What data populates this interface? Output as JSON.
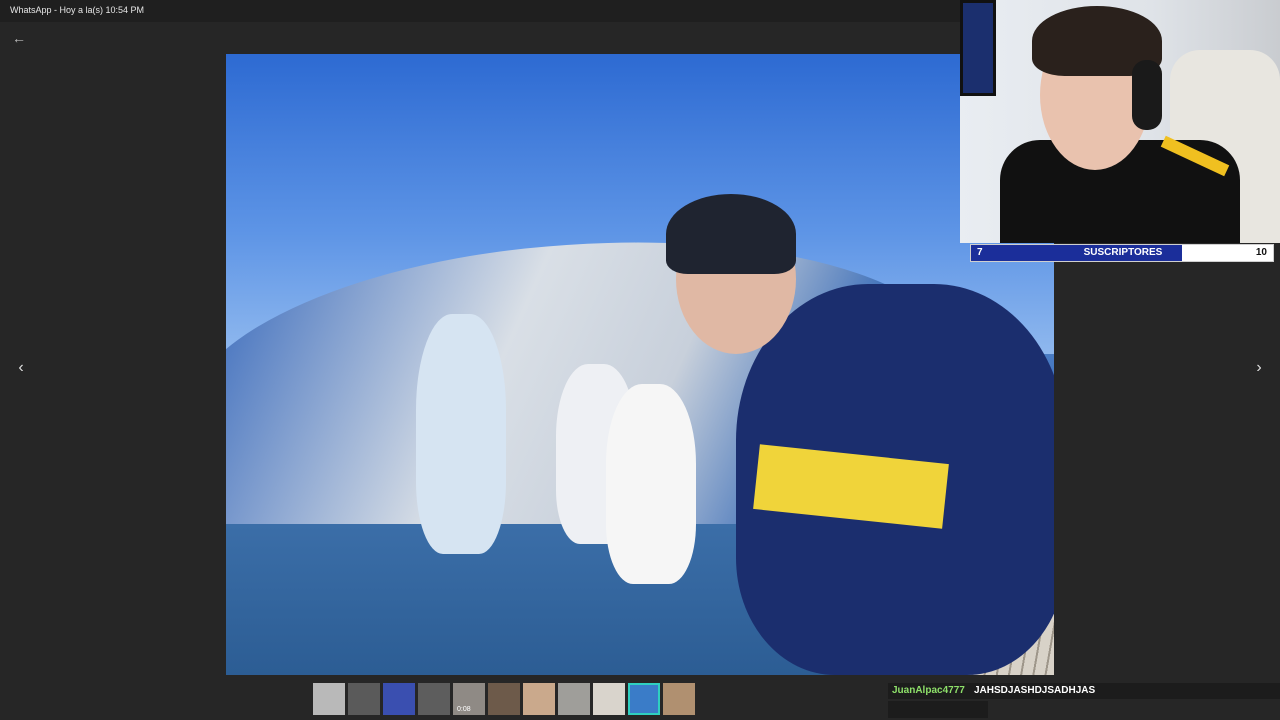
{
  "window": {
    "title": "WhatsApp - Hoy a la(s) 10:54 PM"
  },
  "nav": {
    "back_icon": "←",
    "prev_icon": "‹",
    "next_icon": "›"
  },
  "overlay": {
    "subscribers": {
      "current": "7",
      "label": "SUSCRIPTORES",
      "goal": "10",
      "progress": 0.7,
      "fill_color": "#1b2e9a"
    },
    "chat": {
      "user": "JuanAlpac4777",
      "separator": " : ",
      "message": "JAHSDJASHDJSADHJAS",
      "user_color": "#8ee06a"
    }
  },
  "thumbnails": [
    {
      "color": "#b9b9b9"
    },
    {
      "color": "#5a5a5a"
    },
    {
      "color": "#3a4fb0"
    },
    {
      "color": "#5d5d5d"
    },
    {
      "color": "#8f8a85",
      "duration": "0:08"
    },
    {
      "color": "#6d5a4a"
    },
    {
      "color": "#caa98c"
    },
    {
      "color": "#9f9e9a"
    },
    {
      "color": "#d9d4cc"
    },
    {
      "color": "#3a7cc8",
      "selected": true
    },
    {
      "color": "#b09070"
    }
  ]
}
